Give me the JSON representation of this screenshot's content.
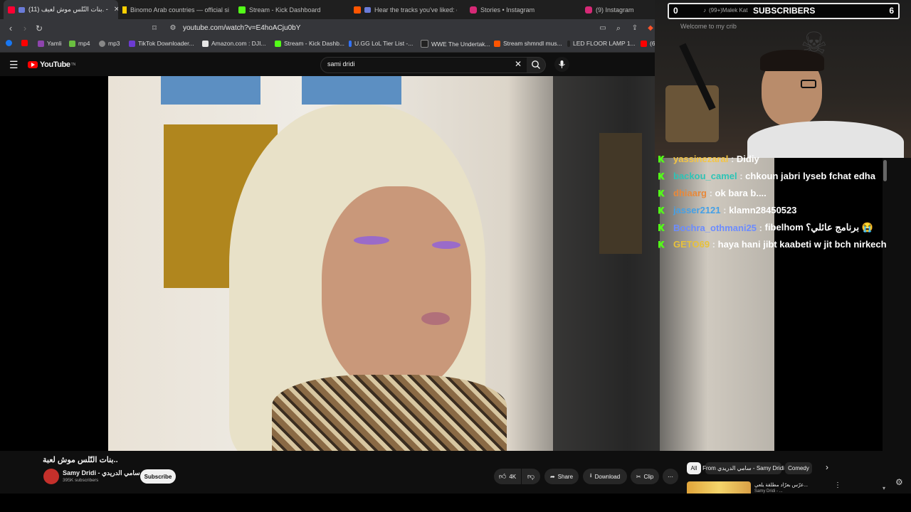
{
  "tabs": [
    {
      "title": "(11) بنات النّلس موش لعيف. -",
      "fav_color": "#ff0033"
    },
    {
      "title": "Binomo Arab countries — official si",
      "fav_color": "#ffd000"
    },
    {
      "title": "Stream - Kick Dashboard",
      "fav_color": "#53fc18"
    },
    {
      "title": "Hear the tracks you've liked: on",
      "fav_color": "#ff5500"
    },
    {
      "title": "Stories • Instagram",
      "fav_color": "#d62976"
    },
    {
      "title": "(9) Instagram",
      "fav_color": "#d62976"
    }
  ],
  "address": {
    "url": "youtube.com/watch?v=E4hoACju0bY"
  },
  "bookmarks": [
    {
      "label": "",
      "color": "#1877f2"
    },
    {
      "label": "",
      "color": "#ff0000"
    },
    {
      "label": "Yamli",
      "color": "#8e44ad"
    },
    {
      "label": "mp4",
      "color": "#6abf40"
    },
    {
      "label": "mp3",
      "color": "#888888"
    },
    {
      "label": "TikTok Downloader...",
      "color": "#6c3bd1"
    },
    {
      "label": "Amazon.com : DJI...",
      "color": "#e6e6e6"
    },
    {
      "label": "Stream - Kick Dashb...",
      "color": "#53fc18"
    },
    {
      "label": "U.GG LoL Tier List -...",
      "color": "#3273fa"
    },
    {
      "label": "WWE The Undertak...",
      "color": "#222222"
    },
    {
      "label": "Stream shmndl mus...",
      "color": "#ff5500"
    },
    {
      "label": "LED FLOOR LAMP 1...",
      "color": "#222222"
    },
    {
      "label": "(6",
      "color": "#ff0000"
    }
  ],
  "youtube": {
    "logo": "YouTube",
    "logo_sup": "TN",
    "search_value": "sami dridi"
  },
  "subscribers": {
    "left": "0",
    "ticker": "(99+)Malek Kat",
    "label": "SUBSCRIBERS",
    "right": "6"
  },
  "cam": {
    "sign": "Welcome to my crib"
  },
  "chat": [
    {
      "user": "yassinezaral",
      "color": "#f5c542",
      "msg": "Didiy"
    },
    {
      "user": "backou_camel",
      "color": "#2ec4b6",
      "msg": "chkoun jabri lyseb fchat edha"
    },
    {
      "user": "dhiaarg",
      "color": "#e8893a",
      "msg": "ok bara b...."
    },
    {
      "user": "jasser2121",
      "color": "#45a0e6",
      "msg": "klamn28450523"
    },
    {
      "user": "Bochra_othmani25",
      "color": "#6c8cff",
      "msg": "fibelhom برنامج عائلي؟ 😭"
    },
    {
      "user": "GETO69",
      "color": "#e7c13b",
      "msg": "haya hani jibt kaabeti w jit bch nirkech"
    }
  ],
  "video": {
    "title": "بنات النّلس موش لعبة..",
    "channel": "Samy Dridi - سامي الدريدي",
    "subscribers": "395K subscribers"
  },
  "actions": {
    "subscribe": "Subscribe",
    "likes": "4K",
    "share": "Share",
    "download": "Download",
    "clip": "Clip"
  },
  "chips": [
    "All",
    "From سامي الدريدي - Samy Dridi",
    "Comedy"
  ],
  "recommendation": {
    "title": "عرّس بعرّاد مطلقة يلعي...",
    "channel": "Samy Dridi - ..."
  }
}
